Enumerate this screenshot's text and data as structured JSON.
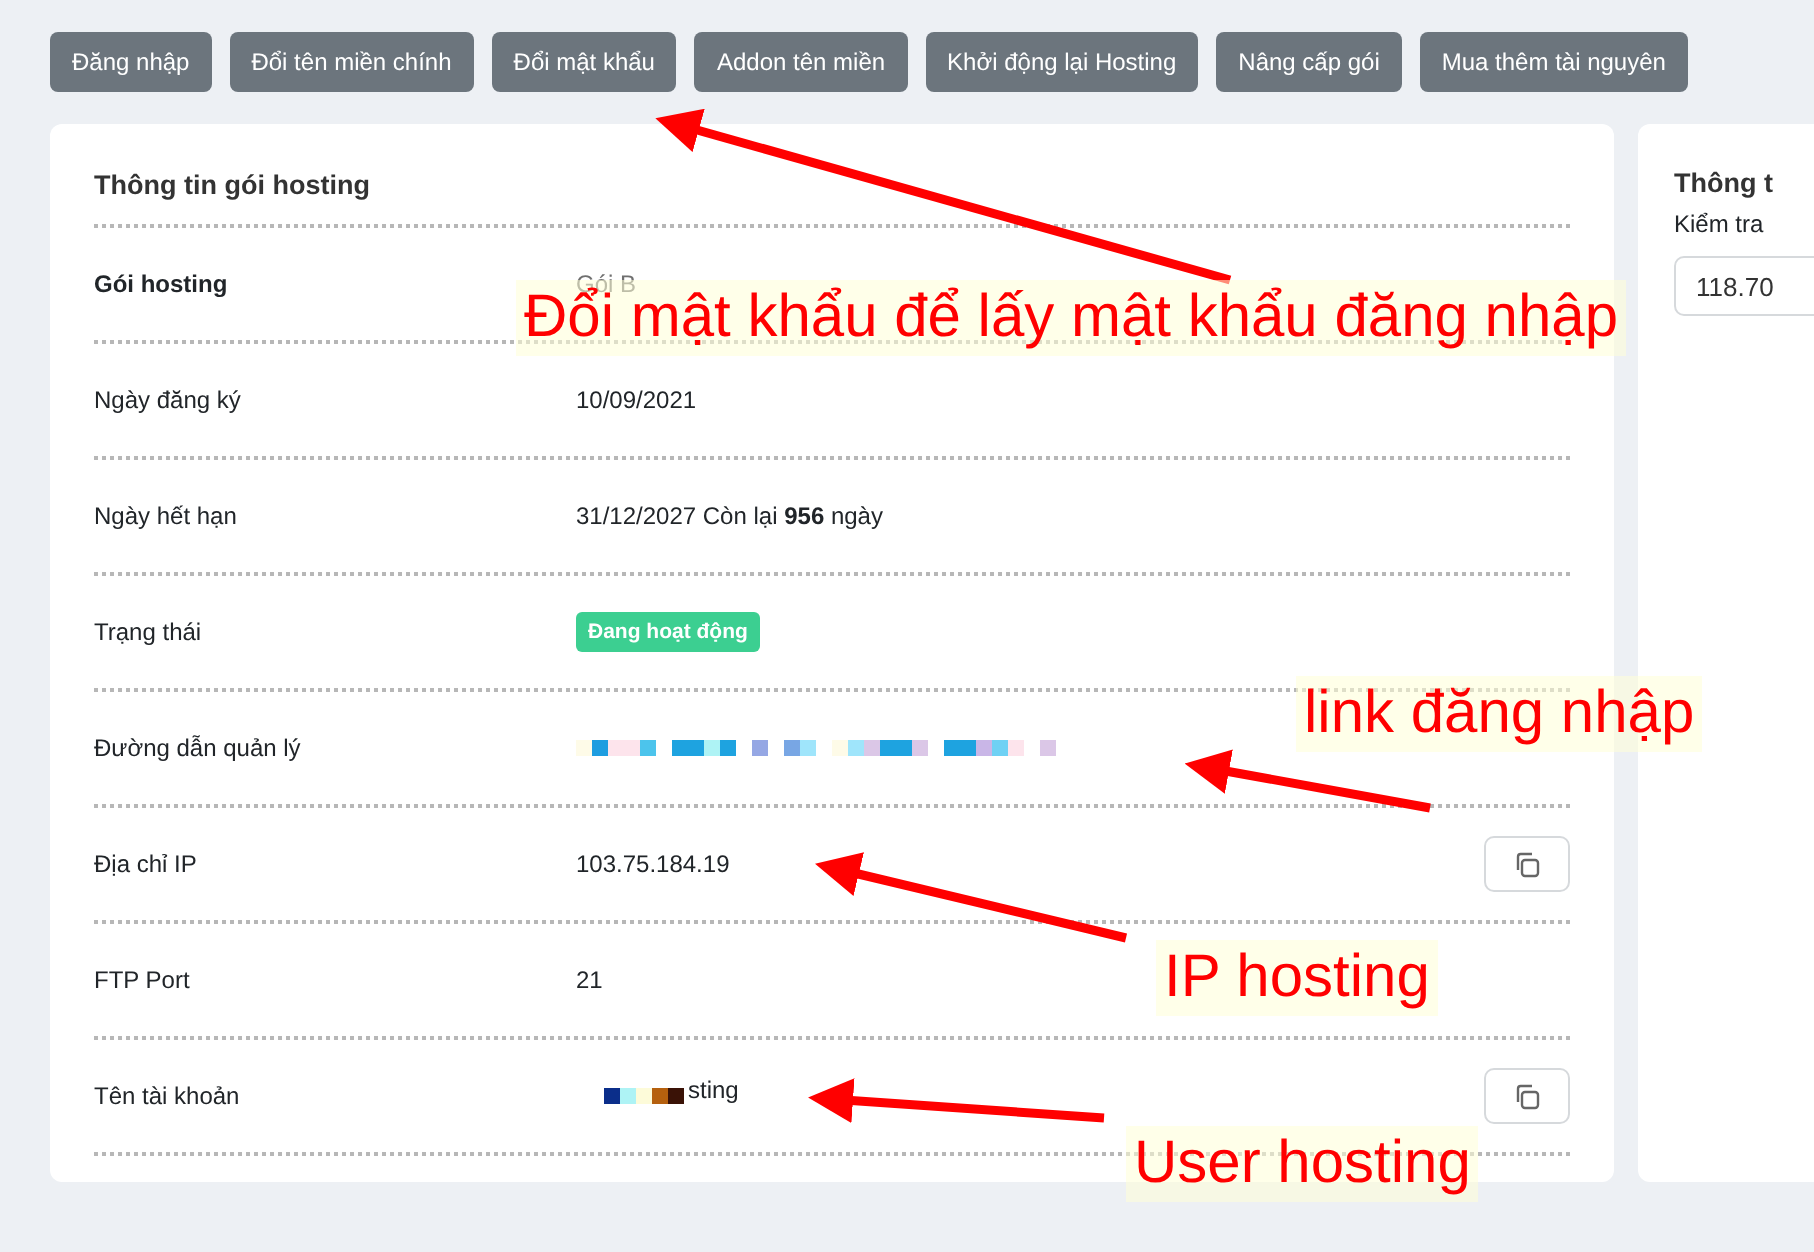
{
  "actions": [
    {
      "label": "Đăng nhập"
    },
    {
      "label": "Đổi tên miền chính"
    },
    {
      "label": "Đổi mật khẩu"
    },
    {
      "label": "Addon tên miền"
    },
    {
      "label": "Khởi động lại Hosting"
    },
    {
      "label": "Nâng cấp gói"
    },
    {
      "label": "Mua thêm tài nguyên"
    }
  ],
  "hosting_card": {
    "title": "Thông tin gói hosting",
    "rows": [
      {
        "label": "Gói hosting",
        "bold": true,
        "kind": "muted",
        "value": "Gói B",
        "copy": false
      },
      {
        "label": "Ngày đăng ký",
        "bold": false,
        "kind": "plain",
        "value": "10/09/2021",
        "copy": false
      },
      {
        "label": "Ngày hết hạn",
        "bold": false,
        "kind": "plain",
        "value": "31/12/2027   Còn lại **956** ngày",
        "copy": false
      },
      {
        "label": "Trạng thái",
        "bold": false,
        "kind": "status",
        "value": "Đang hoạt động",
        "copy": false
      },
      {
        "label": "Đường dẫn quản lý",
        "bold": false,
        "kind": "redacted",
        "copy": false
      },
      {
        "label": "Địa chỉ IP",
        "bold": false,
        "kind": "plain",
        "value": "103.75.184.19",
        "copy": true
      },
      {
        "label": "FTP Port",
        "bold": false,
        "kind": "plain",
        "value": "21",
        "copy": false
      },
      {
        "label": "Tên tài khoản",
        "bold": false,
        "kind": "redacted",
        "value": "sting",
        "copy": true
      }
    ]
  },
  "side_card": {
    "title": "Thông t",
    "label": "Kiểm tra",
    "input_value": "118.70"
  },
  "annotations": [
    {
      "text": "Đổi mật khẩu để lấy mật khẩu đăng nhập"
    },
    {
      "text": "link đăng nhập"
    },
    {
      "text": "IP hosting"
    },
    {
      "text": "User hosting"
    }
  ]
}
